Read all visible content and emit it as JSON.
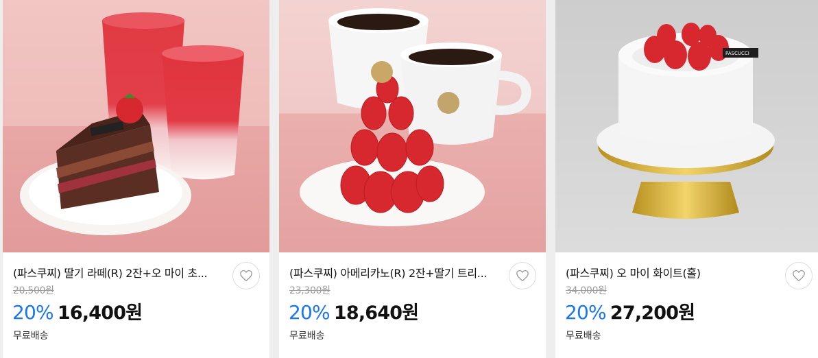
{
  "products": [
    {
      "title": "(파스쿠찌) 딸기 라떼(R) 2잔+오 마이 초...",
      "original_price": "20,500원",
      "discount": "20%",
      "price": "16,400원",
      "shipping": "무료배송",
      "brand_mark": "PASCUCCI"
    },
    {
      "title": "(파스쿠찌) 아메리카노(R) 2잔+딸기 트리...",
      "original_price": "23,300원",
      "discount": "20%",
      "price": "18,640원",
      "shipping": "무료배송"
    },
    {
      "title": "(파스쿠찌) 오 마이 화이트(홀)",
      "original_price": "34,000원",
      "discount": "20%",
      "price": "27,200원",
      "shipping": "무료배송",
      "brand_mark": "PASCUCCI"
    }
  ],
  "colors": {
    "discount": "#1976f2",
    "strawberry": "#d8282f",
    "pink_bg": "#eab3b3",
    "gray_bg": "#d4d4d4"
  },
  "icons": [
    "heart-outline-icon"
  ]
}
